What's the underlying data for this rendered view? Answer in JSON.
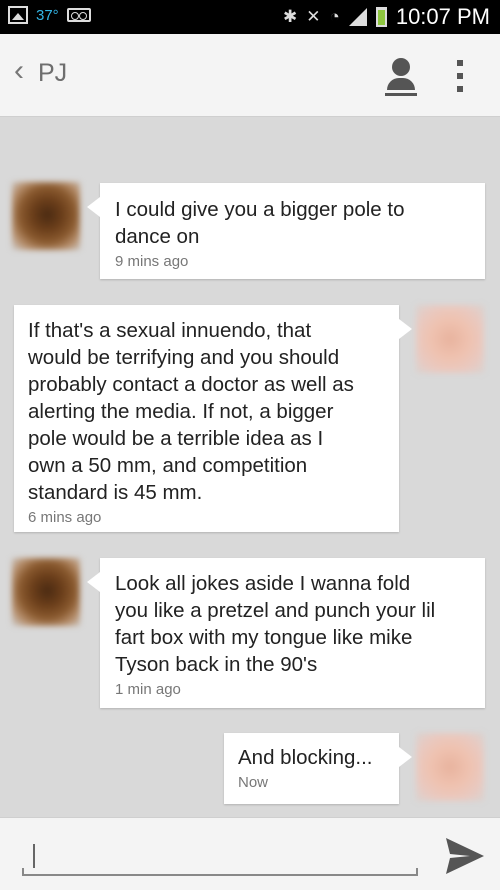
{
  "status_bar": {
    "temperature": "37°",
    "time": "10:07 PM",
    "icons": [
      "picture-icon",
      "voicemail-icon",
      "bluetooth-icon",
      "mute-icon",
      "wifi-icon",
      "signal-icon",
      "battery-icon"
    ]
  },
  "header": {
    "back_glyph": "‹",
    "contact_name": "PJ"
  },
  "messages": [
    {
      "direction": "incoming",
      "text": "I could give you a bigger pole to\ndance on",
      "time": "9 mins ago"
    },
    {
      "direction": "outgoing",
      "text": "If that's a sexual innuendo, that\nwould be terrifying and you should\nprobably contact a doctor as well as\nalerting the media.  If not, a bigger\npole would be a terrible idea as I\nown a 50 mm, and competition\nstandard is 45 mm.",
      "time": "6 mins ago"
    },
    {
      "direction": "incoming",
      "text": "Look all jokes aside I wanna fold\nyou like a pretzel and punch your lil\nfart box with my tongue like mike\nTyson back in the 90's",
      "time": "1 min ago"
    },
    {
      "direction": "outgoing",
      "text": "And blocking...",
      "time": "Now"
    }
  ],
  "compose": {
    "value": "",
    "placeholder": ""
  },
  "colors": {
    "temperature": "#33b5e5",
    "battery": "#8ec63f",
    "background": "#d9d9d9"
  }
}
